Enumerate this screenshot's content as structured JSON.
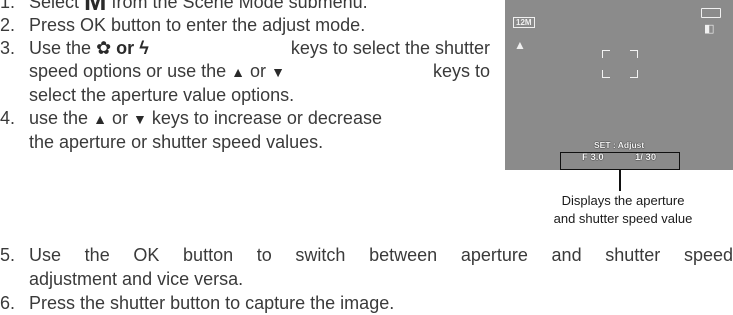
{
  "steps_top": [
    {
      "num": "1.",
      "before": "Select ",
      "symbol": "M",
      "after": " from the Scene Mode submenu."
    },
    {
      "num": "2.",
      "text": "Press OK button to enter the adjust mode."
    },
    {
      "num": "3.",
      "lines": [
        "Use the",
        "or",
        "keys to select the shutter",
        "speed options or use the",
        "or",
        "keys to",
        "select the aperture value options."
      ],
      "left_key_icon": "macro-flower-icon",
      "right_key_icon": "flash-bolt-icon",
      "up_icon": "up-triangle-icon",
      "down_icon": "down-triangle-icon"
    },
    {
      "num": "4.",
      "lines": [
        "use the",
        "or",
        "keys to increase or decrease",
        "the aperture or shutter speed values."
      ]
    }
  ],
  "screen": {
    "background": "#8b8b8b",
    "icons": {
      "resolution": "12M",
      "quality": "quality-icon",
      "battery": "battery-icon",
      "card": "memory-card-icon"
    },
    "set_label": "SET : Adjust",
    "aperture": "F 3.0",
    "shutter": "1/ 30"
  },
  "caption": [
    "Displays the aperture",
    "and shutter speed value"
  ],
  "steps_bottom": [
    {
      "num": "5.",
      "line1": "Use the OK button to switch between aperture and shutter speed",
      "line2": "adjustment and vice versa."
    },
    {
      "num": "6.",
      "text": "Press the shutter button to capture the image."
    }
  ]
}
